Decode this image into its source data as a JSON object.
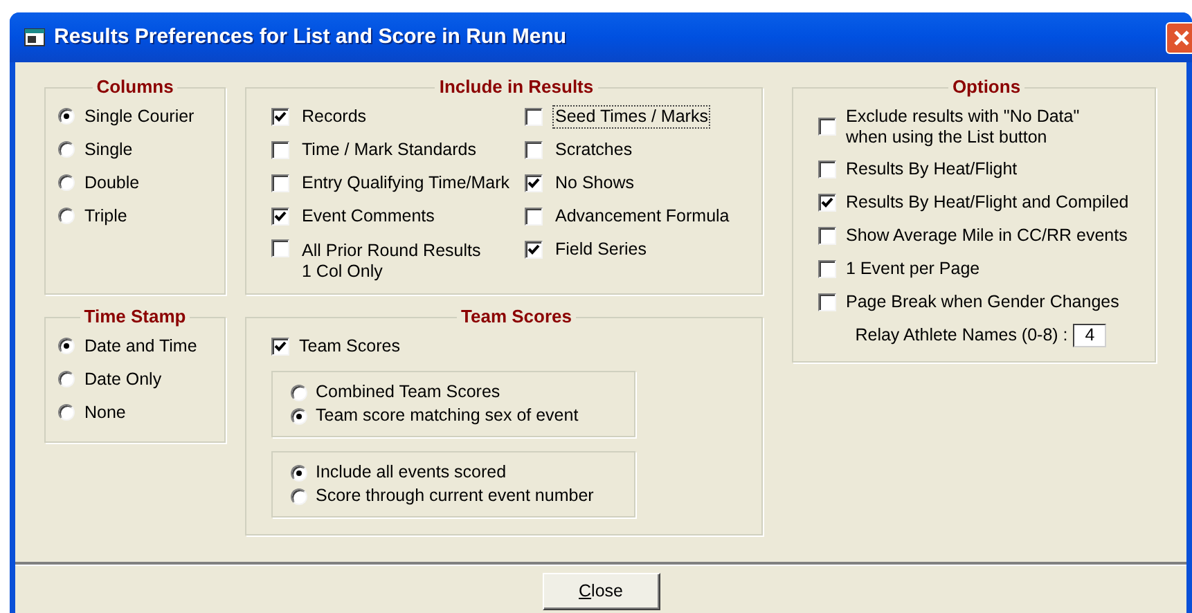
{
  "window": {
    "title": "Results Preferences for List and Score in Run Menu"
  },
  "columns_group": {
    "title": "Columns",
    "options": [
      {
        "label": "Single Courier",
        "selected": true
      },
      {
        "label": "Single",
        "selected": false
      },
      {
        "label": "Double",
        "selected": false
      },
      {
        "label": "Triple",
        "selected": false
      }
    ]
  },
  "time_stamp": {
    "title": "Time Stamp",
    "options": [
      {
        "label": "Date and Time",
        "selected": true
      },
      {
        "label": "Date Only",
        "selected": false
      },
      {
        "label": "None",
        "selected": false
      }
    ]
  },
  "include_in_results": {
    "title": "Include in Results",
    "columns": [
      [
        {
          "label": "Records",
          "checked": true,
          "focused": false
        },
        {
          "label": "Time / Mark Standards",
          "checked": false,
          "focused": false
        },
        {
          "label": "Entry Qualifying Time/Mark",
          "checked": false,
          "focused": false
        },
        {
          "label": "Event Comments",
          "checked": true,
          "focused": false
        },
        {
          "label": "All Prior Round Results\n1 Col Only",
          "checked": false,
          "focused": false
        }
      ],
      [
        {
          "label": "Seed Times / Marks",
          "checked": false,
          "focused": true
        },
        {
          "label": "Scratches",
          "checked": false,
          "focused": false
        },
        {
          "label": "No Shows",
          "checked": true,
          "focused": false
        },
        {
          "label": "Advancement Formula",
          "checked": false,
          "focused": false
        },
        {
          "label": "Field Series",
          "checked": true,
          "focused": false
        }
      ]
    ]
  },
  "team_scores": {
    "title": "Team Scores",
    "checkbox": {
      "label": "Team Scores",
      "checked": true
    },
    "radio_groups": [
      [
        {
          "label": "Combined Team Scores",
          "selected": false
        },
        {
          "label": "Team score matching sex of event",
          "selected": true
        }
      ],
      [
        {
          "label": "Include all events scored",
          "selected": true
        },
        {
          "label": "Score through current event number",
          "selected": false
        }
      ]
    ]
  },
  "options": {
    "title": "Options",
    "items": [
      {
        "label": "Exclude results with \"No Data\"\nwhen using the List button",
        "checked": false
      },
      {
        "label": "Results By Heat/Flight",
        "checked": false
      },
      {
        "label": "Results By Heat/Flight and Compiled",
        "checked": true
      },
      {
        "label": "Show Average Mile in CC/RR events",
        "checked": false
      },
      {
        "label": "1 Event per Page",
        "checked": false
      },
      {
        "label": "Page Break when Gender Changes",
        "checked": false
      }
    ],
    "relay_field": {
      "label": "Relay Athlete Names (0-8) :",
      "value": "4"
    }
  },
  "buttons": [
    {
      "label": "Close"
    }
  ]
}
